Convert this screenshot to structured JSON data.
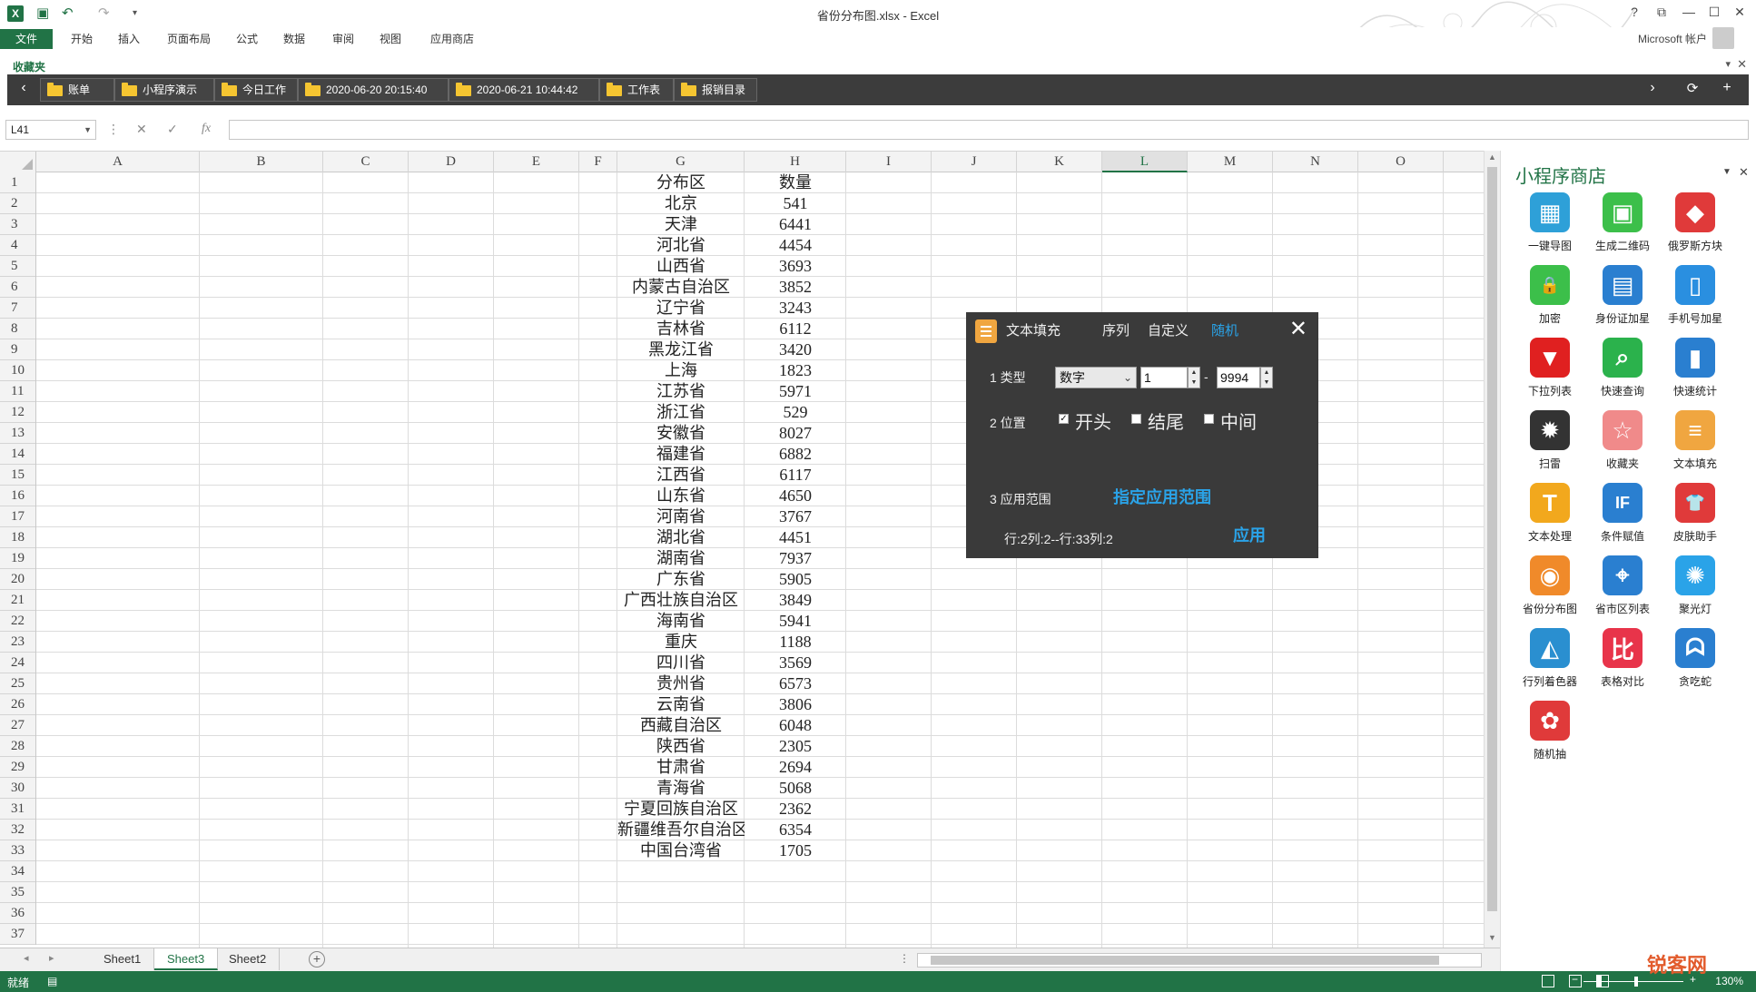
{
  "window": {
    "title": "省份分布图.xlsx - Excel",
    "help": "?",
    "account": "Microsoft 帐户"
  },
  "ribbon": {
    "tabs": [
      "文件",
      "开始",
      "插入",
      "页面布局",
      "公式",
      "数据",
      "审阅",
      "视图",
      "应用商店"
    ]
  },
  "favorites": {
    "label": "收藏夹",
    "items": [
      "账单",
      "小程序演示",
      "今日工作",
      "2020-06-20 20:15:40",
      "2020-06-21 10:44:42",
      "工作表",
      "报销目录"
    ]
  },
  "formula": {
    "name_box": "L41",
    "fx": "fx",
    "value": ""
  },
  "grid": {
    "columns": [
      "A",
      "B",
      "C",
      "D",
      "E",
      "F",
      "G",
      "H",
      "I",
      "J",
      "K",
      "L",
      "M",
      "N",
      "O"
    ],
    "active_column": "L",
    "row_count": 37,
    "header_row": [
      "分布区",
      "数量"
    ],
    "rows": [
      [
        "北京",
        "541"
      ],
      [
        "天津",
        "6441"
      ],
      [
        "河北省",
        "4454"
      ],
      [
        "山西省",
        "3693"
      ],
      [
        "内蒙古自治区",
        "3852"
      ],
      [
        "辽宁省",
        "3243"
      ],
      [
        "吉林省",
        "6112"
      ],
      [
        "黑龙江省",
        "3420"
      ],
      [
        "上海",
        "1823"
      ],
      [
        "江苏省",
        "5971"
      ],
      [
        "浙江省",
        "529"
      ],
      [
        "安徽省",
        "8027"
      ],
      [
        "福建省",
        "6882"
      ],
      [
        "江西省",
        "6117"
      ],
      [
        "山东省",
        "4650"
      ],
      [
        "河南省",
        "3767"
      ],
      [
        "湖北省",
        "4451"
      ],
      [
        "湖南省",
        "7937"
      ],
      [
        "广东省",
        "5905"
      ],
      [
        "广西壮族自治区",
        "3849"
      ],
      [
        "海南省",
        "5941"
      ],
      [
        "重庆",
        "1188"
      ],
      [
        "四川省",
        "3569"
      ],
      [
        "贵州省",
        "6573"
      ],
      [
        "云南省",
        "3806"
      ],
      [
        "西藏自治区",
        "6048"
      ],
      [
        "陕西省",
        "2305"
      ],
      [
        "甘肃省",
        "2694"
      ],
      [
        "青海省",
        "5068"
      ],
      [
        "宁夏回族自治区",
        "2362"
      ],
      [
        "新疆维吾尔自治区",
        "6354"
      ],
      [
        "中国台湾省",
        "1705"
      ]
    ]
  },
  "sheets": {
    "tabs": [
      "Sheet1",
      "Sheet3",
      "Sheet2"
    ],
    "active": "Sheet3"
  },
  "status": {
    "ready": "就绪",
    "zoom": "130%"
  },
  "panel": {
    "title": "小程序商店",
    "apps": [
      {
        "label": "一键导图",
        "icon": "image-icon",
        "color": "#2ea0d8",
        "glyph": "▦"
      },
      {
        "label": "生成二维码",
        "icon": "qrcode-icon",
        "color": "#3cbf4a",
        "glyph": "▣"
      },
      {
        "label": "俄罗斯方块",
        "icon": "cube-icon",
        "color": "#e03a3a",
        "glyph": "◆"
      },
      {
        "label": "加密",
        "icon": "lock-icon",
        "color": "#3cbf4a",
        "glyph": "🔒"
      },
      {
        "label": "身份证加星",
        "icon": "idcard-icon",
        "color": "#2a7fd0",
        "glyph": "▤"
      },
      {
        "label": "手机号加星",
        "icon": "phone-icon",
        "color": "#2a8fe0",
        "glyph": "▯"
      },
      {
        "label": "下拉列表",
        "icon": "dropdown-icon",
        "color": "#e02020",
        "glyph": "▼"
      },
      {
        "label": "快速查询",
        "icon": "search-icon",
        "color": "#2bb24c",
        "glyph": "⌕"
      },
      {
        "label": "快速统计",
        "icon": "barchart-icon",
        "color": "#2a7fd0",
        "glyph": "▮"
      },
      {
        "label": "扫雷",
        "icon": "mine-icon",
        "color": "#333333",
        "glyph": "✹"
      },
      {
        "label": "收藏夹",
        "icon": "star-icon",
        "color": "#f08a8a",
        "glyph": "☆"
      },
      {
        "label": "文本填充",
        "icon": "textfill-icon",
        "color": "#f0a640",
        "glyph": "≡"
      },
      {
        "label": "文本处理",
        "icon": "text-icon",
        "color": "#f2a81d",
        "glyph": "T"
      },
      {
        "label": "条件赋值",
        "icon": "if-icon",
        "color": "#2a7fd0",
        "glyph": "IF"
      },
      {
        "label": "皮肤助手",
        "icon": "shirt-icon",
        "color": "#e03a3a",
        "glyph": "👕"
      },
      {
        "label": "省份分布图",
        "icon": "map-icon",
        "color": "#f08a2a",
        "glyph": "◉"
      },
      {
        "label": "省市区列表",
        "icon": "location-icon",
        "color": "#2a7fd0",
        "glyph": "⌖"
      },
      {
        "label": "聚光灯",
        "icon": "bulb-icon",
        "color": "#2aa3e8",
        "glyph": "✺"
      },
      {
        "label": "行列着色器",
        "icon": "paint-icon",
        "color": "#2a8fd0",
        "glyph": "◭"
      },
      {
        "label": "表格对比",
        "icon": "compare-icon",
        "color": "#e8344a",
        "glyph": "比"
      },
      {
        "label": "贪吃蛇",
        "icon": "ghost-icon",
        "color": "#2a7fd0",
        "glyph": "ᗣ"
      },
      {
        "label": "随机抽",
        "icon": "wheel-icon",
        "color": "#e03a3a",
        "glyph": "✿"
      }
    ]
  },
  "dialog": {
    "title": "文本填充",
    "tabs": [
      "序列",
      "自定义",
      "随机"
    ],
    "active_tab": "随机",
    "type_label": "1 类型",
    "type_value": "数字",
    "min": "1",
    "dash": "-",
    "max": "9994",
    "position_label": "2 位置",
    "positions": [
      {
        "label": "开头",
        "checked": true
      },
      {
        "label": "结尾",
        "checked": false
      },
      {
        "label": "中间",
        "checked": false
      }
    ],
    "range_label": "3 应用范围",
    "range_button": "指定应用范围",
    "range_info": "行:2列:2--行:33列:2",
    "apply_button": "应用"
  },
  "watermark": "锐客网"
}
